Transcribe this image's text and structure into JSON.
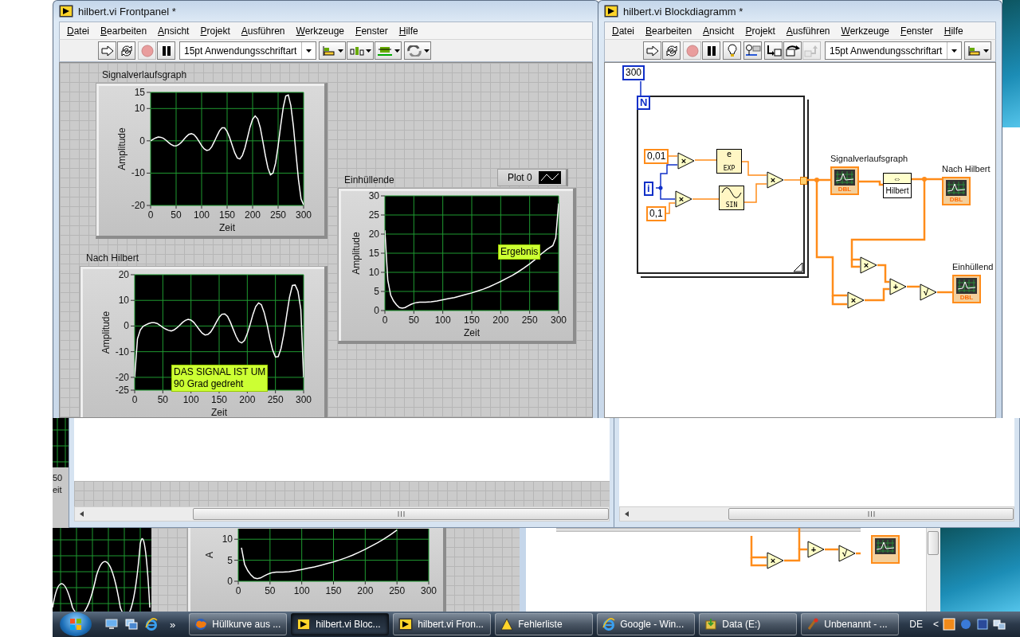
{
  "front_panel": {
    "title": "hilbert.vi Frontpanel *",
    "menu": [
      "Datei",
      "Bearbeiten",
      "Ansicht",
      "Projekt",
      "Ausführen",
      "Werkzeuge",
      "Fenster",
      "Hilfe"
    ],
    "tools": [
      {
        "kind": "run",
        "disabled": false
      },
      {
        "kind": "run_continuously",
        "disabled": false
      },
      {
        "kind": "abort",
        "disabled": true
      },
      {
        "kind": "pause",
        "disabled": false
      },
      {
        "kind": "font",
        "text": "15pt Anwendungsschriftart",
        "disabled": false
      },
      {
        "kind": "align",
        "disabled": false
      },
      {
        "kind": "distribute",
        "disabled": false
      },
      {
        "kind": "resize",
        "disabled": false
      },
      {
        "kind": "reorder",
        "disabled": false
      }
    ],
    "graphs": [
      {
        "label": "Signalverlaufsgraph",
        "chart_data": {
          "type": "line",
          "xlabel": "Zeit",
          "ylabel": "Amplitude",
          "x": [
            0,
            5,
            10,
            15,
            20,
            25,
            30,
            35,
            40,
            45,
            50,
            55,
            60,
            65,
            70,
            75,
            80,
            85,
            90,
            95,
            100,
            105,
            110,
            115,
            120,
            125,
            130,
            135,
            140,
            145,
            150,
            155,
            160,
            165,
            170,
            175,
            180,
            185,
            190,
            195,
            200,
            205,
            210,
            215,
            220,
            225,
            230,
            235,
            240,
            245,
            250,
            255,
            260,
            265,
            270,
            275,
            280,
            285,
            290,
            295,
            300
          ],
          "series": [
            {
              "color": "#ffffff",
              "values": [
                0,
                0.5,
                0.9,
                1.2,
                1.1,
                0.8,
                0.2,
                -0.5,
                -1.1,
                -1.5,
                -1.6,
                -1.2,
                -0.5,
                0.4,
                1.3,
                2.0,
                2.2,
                1.9,
                1.0,
                -0.2,
                -1.5,
                -2.5,
                -3.0,
                -2.8,
                -1.8,
                -0.2,
                1.5,
                3.1,
                4.0,
                4.0,
                2.9,
                1.0,
                -1.4,
                -3.7,
                -5.3,
                -5.6,
                -4.5,
                -2.2,
                1.0,
                4.3,
                6.7,
                7.7,
                6.8,
                4.1,
                -0.1,
                -4.6,
                -8.4,
                -10.5,
                -10.0,
                -6.9,
                -1.6,
                4.6,
                10.3,
                13.9,
                14.2,
                10.9,
                4.5,
                -3.9,
                -12.1,
                -18.0,
                -19.8
              ]
            }
          ],
          "xlim": [
            0,
            300
          ],
          "ylim": [
            -20,
            15
          ],
          "xticks": [
            0,
            50,
            100,
            150,
            200,
            250,
            300
          ],
          "yticks": [
            -20,
            -10,
            0,
            10,
            15
          ],
          "grid": true
        }
      },
      {
        "label": "Nach Hilbert",
        "note": {
          "lines": [
            "DAS SIGNAL IST UM",
            "90 Grad gedreht"
          ]
        },
        "chart_data": {
          "type": "line",
          "xlabel": "Zeit",
          "ylabel": "Amplitude",
          "x": [
            0,
            5,
            10,
            15,
            20,
            25,
            30,
            35,
            40,
            45,
            50,
            55,
            60,
            65,
            70,
            75,
            80,
            85,
            90,
            95,
            100,
            105,
            110,
            115,
            120,
            125,
            130,
            135,
            140,
            145,
            150,
            155,
            160,
            165,
            170,
            175,
            180,
            185,
            190,
            195,
            200,
            205,
            210,
            215,
            220,
            225,
            230,
            235,
            240,
            245,
            250,
            255,
            260,
            265,
            270,
            275,
            280,
            285,
            290,
            295,
            300
          ],
          "series": [
            {
              "color": "#ffffff",
              "values": [
                -20,
                -5,
                -1.5,
                -0.1,
                0.5,
                1.0,
                1.3,
                1.3,
                1.0,
                0.3,
                -0.5,
                -1.2,
                -1.7,
                -1.9,
                -1.5,
                -0.7,
                0.3,
                1.4,
                2.2,
                2.6,
                2.3,
                1.4,
                0.0,
                -1.5,
                -2.8,
                -3.5,
                -3.3,
                -2.3,
                -0.6,
                1.5,
                3.4,
                4.6,
                4.7,
                3.7,
                1.5,
                -1.3,
                -4.0,
                -6.0,
                -6.6,
                -5.6,
                -3.0,
                0.6,
                4.5,
                7.6,
                9.0,
                8.3,
                5.3,
                0.7,
                -4.7,
                -9.3,
                -12.1,
                -11.9,
                -8.7,
                -2.9,
                4.3,
                11.2,
                15.8,
                16.0,
                13.6,
                6.5,
                -20
              ]
            }
          ],
          "xlim": [
            0,
            300
          ],
          "ylim": [
            -25,
            20
          ],
          "xticks": [
            0,
            50,
            100,
            150,
            200,
            250,
            300
          ],
          "yticks": [
            -25,
            -20,
            -10,
            0,
            10,
            20
          ],
          "grid": true
        }
      },
      {
        "label": "Einhüllende",
        "legend": true,
        "note": {
          "lines": [
            "Ergebnis"
          ]
        },
        "chart_data": {
          "type": "line",
          "xlabel": "Zeit",
          "ylabel": "Amplitude",
          "x": [
            0,
            5,
            10,
            15,
            20,
            25,
            30,
            35,
            40,
            45,
            50,
            55,
            60,
            70,
            80,
            90,
            100,
            110,
            120,
            130,
            140,
            150,
            160,
            170,
            180,
            190,
            200,
            210,
            220,
            230,
            240,
            250,
            260,
            270,
            280,
            290,
            295,
            300
          ],
          "series": [
            {
              "name": "Plot 0",
              "color": "#ffffff",
              "values": [
                21,
                8,
                4,
                2.5,
                1.5,
                0.8,
                0.6,
                0.8,
                1.2,
                1.6,
                1.9,
                2.1,
                2.2,
                2.2,
                2.3,
                2.5,
                2.8,
                3.1,
                3.4,
                3.8,
                4.2,
                4.6,
                5.1,
                5.6,
                6.2,
                6.9,
                7.6,
                8.4,
                9.2,
                10.1,
                11.1,
                12.2,
                13.4,
                14.8,
                16.0,
                17.0,
                19,
                28
              ]
            }
          ],
          "xlim": [
            0,
            300
          ],
          "ylim": [
            0,
            30
          ],
          "xticks": [
            0,
            50,
            100,
            150,
            200,
            250,
            300
          ],
          "yticks": [
            0,
            5,
            10,
            15,
            20,
            25,
            30
          ],
          "grid": true
        }
      }
    ]
  },
  "block_diagram": {
    "title": "hilbert.vi Blockdiagramm *",
    "menu": [
      "Datei",
      "Bearbeiten",
      "Ansicht",
      "Projekt",
      "Ausführen",
      "Werkzeuge",
      "Fenster",
      "Hilfe"
    ],
    "tools": [
      {
        "kind": "run",
        "disabled": false
      },
      {
        "kind": "run_continuously",
        "disabled": false
      },
      {
        "kind": "abort",
        "disabled": true
      },
      {
        "kind": "pause",
        "disabled": false
      },
      {
        "kind": "highlight",
        "disabled": false
      },
      {
        "kind": "retain",
        "disabled": false
      },
      {
        "kind": "step_into",
        "disabled": false
      },
      {
        "kind": "step_over",
        "disabled": false
      },
      {
        "kind": "step_out",
        "disabled": true
      },
      {
        "kind": "font",
        "text": "15pt Anwendungsschriftart",
        "disabled": false
      },
      {
        "kind": "align",
        "disabled": false
      }
    ],
    "nodes": [
      {
        "kind": "constant",
        "color": "#1030c8",
        "text": "300"
      },
      {
        "kind": "terminal",
        "text": "N"
      },
      {
        "kind": "constant",
        "color": "#ff8c1a",
        "text": "0,01"
      },
      {
        "kind": "terminal",
        "text": "i"
      },
      {
        "kind": "constant",
        "color": "#ff8c1a",
        "text": "0,1"
      },
      {
        "kind": "operator",
        "text": "×"
      },
      {
        "kind": "operator",
        "text": "×"
      },
      {
        "kind": "function",
        "symbol": "e",
        "text": "EXP"
      },
      {
        "kind": "function",
        "text": "SIN"
      },
      {
        "kind": "operator",
        "text": "×"
      },
      {
        "kind": "indicator",
        "label": "Signalverlaufsgraph",
        "text": "DBL"
      },
      {
        "kind": "subvi",
        "symbol": "⇔",
        "text": "Hilbert"
      },
      {
        "kind": "indicator",
        "label": "Nach Hilbert",
        "text": "DBL"
      },
      {
        "kind": "operator",
        "text": "×"
      },
      {
        "kind": "operator",
        "text": "×"
      },
      {
        "kind": "operator",
        "text": "+"
      },
      {
        "kind": "operator",
        "text": "√"
      },
      {
        "kind": "indicator",
        "label": "Einhüllend",
        "text": "DBL"
      }
    ]
  },
  "background": {
    "left_fragment": {
      "tick": "50",
      "axis_title": "eit"
    },
    "graph": {
      "chart_data": {
        "type": "line",
        "ylabel": "A",
        "x": [
          5,
          10,
          15,
          20,
          25,
          30,
          35,
          40,
          45,
          50,
          55,
          60,
          70,
          80,
          90,
          100,
          110,
          120,
          130,
          140,
          150,
          160,
          170,
          180,
          190,
          200,
          210,
          220,
          230,
          240,
          250
        ],
        "series": [
          {
            "color": "#ffffff",
            "values": [
              8,
              4,
              2.5,
              1.5,
              0.8,
              0.6,
              0.8,
              1.2,
              1.6,
              1.9,
              2.1,
              2.2,
              2.2,
              2.3,
              2.5,
              2.8,
              3.1,
              3.4,
              3.8,
              4.2,
              4.6,
              5.1,
              5.6,
              6.2,
              6.9,
              7.6,
              8.4,
              9.2,
              10.1,
              11.1,
              12.2
            ]
          }
        ],
        "xlim": [
          0,
          300
        ],
        "ylim": [
          0,
          12.5
        ],
        "xticks": [
          0,
          50,
          100,
          150,
          200,
          250,
          300
        ],
        "yticks": [
          0,
          5,
          10
        ],
        "grid": true
      }
    },
    "diagram_ops": [
      {
        "text": "×"
      },
      {
        "text": "+"
      },
      {
        "text": "√"
      }
    ]
  },
  "taskbar": {
    "quick_launch_more": "»",
    "items": [
      {
        "kind": "firefox",
        "label": "Hüllkurve aus ...",
        "selected": false
      },
      {
        "kind": "labview",
        "label": "hilbert.vi Bloc...",
        "selected": true
      },
      {
        "kind": "labview",
        "label": "hilbert.vi Fron...",
        "selected": false
      },
      {
        "kind": "error_list",
        "label": "Fehlerliste",
        "selected": false
      },
      {
        "kind": "ie",
        "label": "Google - Win...",
        "selected": false
      },
      {
        "kind": "drive",
        "label": "Data (E:)",
        "selected": false
      },
      {
        "kind": "paint",
        "label": "Unbenannt - ...",
        "selected": false
      }
    ],
    "language": "DE",
    "tray_toggle": "<"
  }
}
